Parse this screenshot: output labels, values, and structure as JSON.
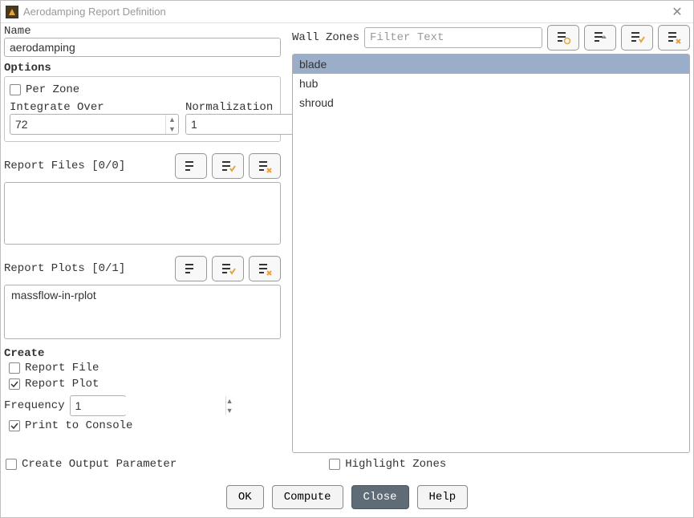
{
  "window": {
    "title": "Aerodamping Report Definition"
  },
  "name": {
    "label": "Name",
    "value": "aerodamping"
  },
  "options": {
    "heading": "Options",
    "per_zone_label": "Per Zone",
    "per_zone_checked": false,
    "integrate_over_label": "Integrate Over",
    "integrate_over_value": "72",
    "normalization_label": "Normalization",
    "normalization_value": "1"
  },
  "report_files": {
    "heading": "Report Files [0/0]",
    "items": []
  },
  "report_plots": {
    "heading": "Report Plots [0/1]",
    "items": [
      "massflow-in-rplot"
    ]
  },
  "create": {
    "heading": "Create",
    "report_file_label": "Report File",
    "report_file_checked": false,
    "report_plot_label": "Report Plot",
    "report_plot_checked": true,
    "frequency_label": "Frequency",
    "frequency_value": "1",
    "print_console_label": "Print to Console",
    "print_console_checked": true
  },
  "output_param": {
    "label": "Create Output Parameter",
    "checked": false
  },
  "wall_zones": {
    "label": "Wall Zones",
    "filter_placeholder": "Filter Text",
    "items": [
      "blade",
      "hub",
      "shroud"
    ],
    "selected_index": 0
  },
  "highlight_zones": {
    "label": "Highlight Zones",
    "checked": false
  },
  "buttons": {
    "ok": "OK",
    "compute": "Compute",
    "close": "Close",
    "help": "Help"
  }
}
